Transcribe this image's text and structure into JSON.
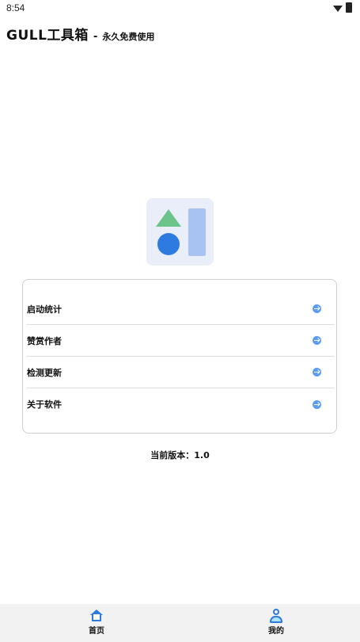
{
  "status_bar": {
    "time": "8:54"
  },
  "header": {
    "title": "GULL工具箱",
    "separator": "-",
    "subtitle": "永久免费使用"
  },
  "logo": {
    "icon": "app-logo-icon",
    "colors": {
      "background": "#e9eef8",
      "triangle": "#6cc48a",
      "circle": "#2d7be0",
      "bar": "#a8c3f2"
    }
  },
  "menu": {
    "items": [
      {
        "label": "启动统计",
        "icon": "arrow-right-circle-icon"
      },
      {
        "label": "赞赏作者",
        "icon": "arrow-right-circle-icon"
      },
      {
        "label": "检测更新",
        "icon": "arrow-right-circle-icon"
      },
      {
        "label": "关于软件",
        "icon": "arrow-right-circle-icon"
      }
    ],
    "accent_color": "#5b9bf5"
  },
  "version": {
    "text": "当前版本：1.0"
  },
  "bottom_nav": {
    "items": [
      {
        "label": "首页",
        "icon": "home-icon"
      },
      {
        "label": "我的",
        "icon": "user-icon"
      }
    ],
    "accent_color": "#2d7be0"
  }
}
